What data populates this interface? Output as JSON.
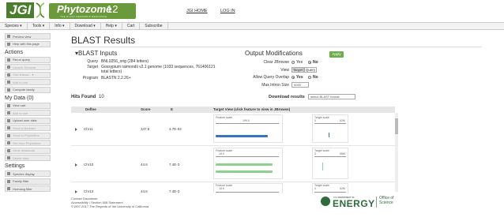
{
  "header": {
    "logo_text": "JGI",
    "app_name": "Phytozome",
    "app_version": "12",
    "app_subtitle": "THE PLANT GENOMICS RESOURCE",
    "links": [
      "JGI HOME",
      "LOG IN"
    ]
  },
  "menubar": {
    "items": [
      "Species ▾",
      "Tools ▾",
      "Info ▾",
      "Download ▾",
      "Help ▾",
      "Cart",
      "Subscribe"
    ]
  },
  "sidebar": {
    "top_buttons": [
      "Preview view",
      "Help with this page"
    ],
    "actions_heading": "Actions",
    "action_buttons": [
      "Rerun query",
      "Launch Jbrowse",
      "Visit linkout... ▾",
      "Add to cart",
      "Compute family"
    ],
    "mydata_heading": "My Data (0)",
    "mydata_buttons": [
      "View cart",
      "Add to cart",
      "Upload user data",
      "Send to BioMart",
      "Send to PhytoMine",
      "Get from PhytoMine",
      "Gene download",
      "Delete data"
    ],
    "settings_heading": "Settings",
    "settings_buttons": [
      "Species display",
      "Family filter",
      "Homolog filter"
    ]
  },
  "main": {
    "title": "BLAST Results",
    "inputs": {
      "heading": "▾BLAST Inputs",
      "query_label": "Query",
      "query_value": "BNL0256_orig (284 letters)",
      "target_label": "Target",
      "target_value_line1": "Gossypium raimondii v2.1 genome (1033 sequences, 761406121",
      "target_value_line2": "total letters)",
      "program_label": "Program",
      "program_value": "BLASTN 2.2.26+"
    },
    "modifications": {
      "heading": "Output Modifications",
      "apply_label": "Apply",
      "clear_jbrowse_label": "Clear JBrowse",
      "clear_jbrowse_options": [
        "Yes",
        "No"
      ],
      "view_label": "View",
      "view_options": [
        "Target",
        "Query"
      ],
      "overlap_label": "Allow Query Overlap",
      "overlap_options": [
        "Yes",
        "No"
      ],
      "max_intron_label": "Max Intron Size",
      "max_intron_value": "5000"
    },
    "hits_label": "Hits Found",
    "hits_value": "10",
    "download_label": "Download results",
    "download_select": "select BLAST format"
  },
  "table": {
    "columns": [
      "Deflne",
      "Score",
      "E",
      "Target View (click feature to view in JBrowse)"
    ],
    "rows": [
      {
        "defline": "Chr11",
        "score": "347.5",
        "evalue": "4.7E-94",
        "feature_label": "Feature scale",
        "feature_max": "199.9",
        "target_label": "Target scale",
        "target_min": "0",
        "target_max": "62M",
        "bar_color": "#3b72c0",
        "bar_frac": 0.83
      },
      {
        "defline": "Chr10",
        "score": "44.6",
        "evalue": "7.4E-3",
        "feature_label": "Feature scale",
        "feature_max": "18.0",
        "target_label": "Target scale",
        "target_min": "0",
        "target_max": "56M",
        "bar_color": "#8fcf8f",
        "bar_frac": 0.9
      },
      {
        "defline": "Chr13",
        "score": "44.6",
        "evalue": "7.4E-3",
        "feature_label": "Feature scale",
        "feature_max": "18.5",
        "target_label": "Target scale",
        "target_min": "0",
        "target_max": "62M",
        "bar_color": "#8fcf8f",
        "bar_frac": 0.9
      }
    ]
  },
  "footer": {
    "links": "Contact   Disclaimer",
    "accessibility": "Accessibility / Section 508 Statement",
    "copyright": "©1997-2017 The Regents of the University of California",
    "doe_small": "U.S. DEPARTMENT OF",
    "doe_energy": "ENERGY",
    "doe_office": [
      "Office of",
      "Science"
    ]
  },
  "colors": {
    "brand_green": "#6a9a3c",
    "apply_green": "#6cae4a",
    "doe_green": "#2e6b3a"
  }
}
